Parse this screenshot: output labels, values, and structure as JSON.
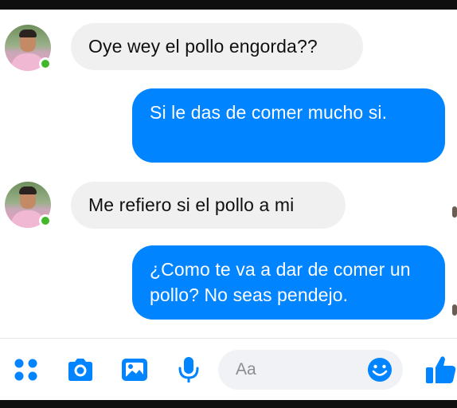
{
  "conversation": {
    "messages": [
      {
        "direction": "incoming",
        "text": "Oye wey el pollo engorda??"
      },
      {
        "direction": "outgoing",
        "text": "Si le das de comer mucho si."
      },
      {
        "direction": "incoming",
        "text": "Me refiero si el pollo a mi"
      },
      {
        "direction": "outgoing",
        "text": "¿Como te va a dar de comer un pollo? No seas pendejo."
      }
    ]
  },
  "composer": {
    "placeholder": "Aa",
    "icons": [
      "more-apps-icon",
      "camera-icon",
      "gallery-icon",
      "microphone-icon",
      "emoji-icon",
      "thumbs-up-icon"
    ]
  },
  "colors": {
    "outgoing_bubble": "#0084ff",
    "incoming_bubble": "#f1f0f0",
    "accent": "#0084ff",
    "online": "#42b72a"
  }
}
